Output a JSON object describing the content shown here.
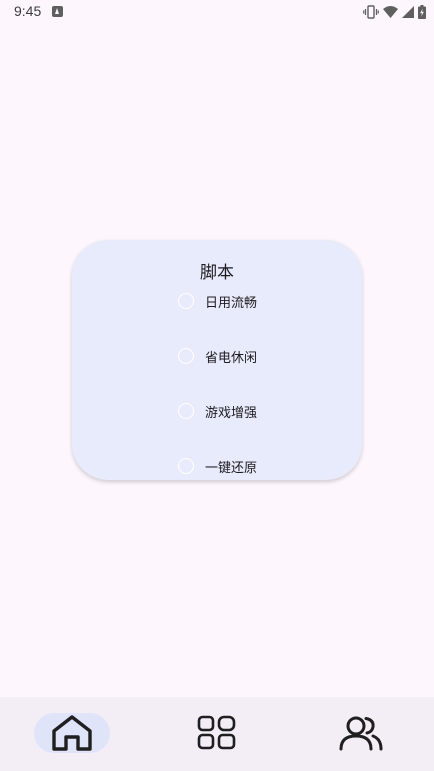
{
  "status_bar": {
    "time": "9:45",
    "icons": [
      "app-notification-icon",
      "vibrate-icon",
      "wifi-icon",
      "signal-icon",
      "battery-icon"
    ]
  },
  "card": {
    "title": "脚本",
    "options": [
      {
        "label": "日用流畅",
        "selected": false
      },
      {
        "label": "省电休闲",
        "selected": false
      },
      {
        "label": "游戏增强",
        "selected": false
      },
      {
        "label": "一键还原",
        "selected": false
      }
    ]
  },
  "bottom_nav": {
    "items": [
      {
        "icon": "home-icon",
        "active": true
      },
      {
        "icon": "apps-grid-icon",
        "active": false
      },
      {
        "icon": "users-icon",
        "active": false
      }
    ]
  },
  "colors": {
    "background": "#fdf7fd",
    "card": "#e8ebfb",
    "nav_bar": "#f3edf6",
    "nav_active_pill": "#e0e4f9",
    "text": "#1c1b1f"
  }
}
